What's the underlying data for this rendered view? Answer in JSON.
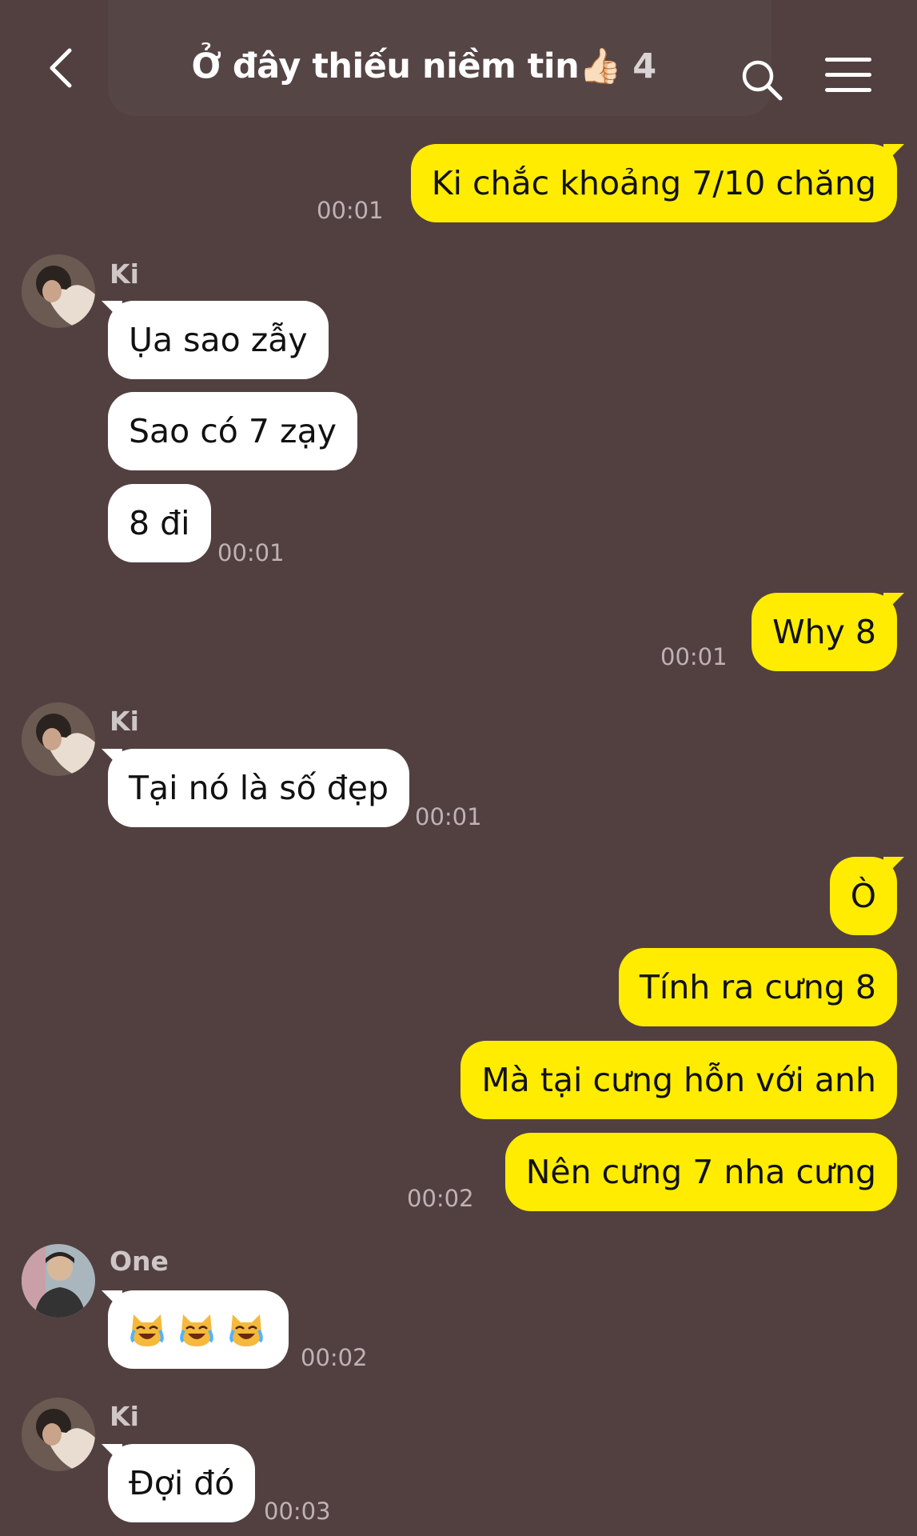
{
  "header": {
    "title": "Ở đây thiếu niềm tin👍🏻",
    "member_count": "4",
    "back_icon": "chevron-left-icon",
    "search_icon": "search-icon",
    "menu_icon": "menu-icon"
  },
  "colors": {
    "background": "#524041",
    "outgoing_bubble": "#ffec00",
    "incoming_bubble": "#ffffff"
  },
  "messages": [
    {
      "direction": "out",
      "text": "Ki chắc khoảng 7/10 chăng",
      "time": "00:01"
    },
    {
      "direction": "in",
      "sender": "Ki",
      "text": "Ụa sao zẫy"
    },
    {
      "direction": "in",
      "text": "Sao có 7 zạy"
    },
    {
      "direction": "in",
      "text": "8 đi",
      "time": "00:01"
    },
    {
      "direction": "out",
      "text": "Why 8",
      "time": "00:01"
    },
    {
      "direction": "in",
      "sender": "Ki",
      "text": "Tại nó là số đẹp",
      "time": "00:01"
    },
    {
      "direction": "out",
      "text": "Ò"
    },
    {
      "direction": "out",
      "text": "Tính ra cưng 8"
    },
    {
      "direction": "out",
      "text": "Mà tại cưng hỗn với anh"
    },
    {
      "direction": "out",
      "text": "Nên cưng 7 nha cưng",
      "time": "00:02"
    },
    {
      "direction": "in",
      "sender": "One",
      "text": "😹😹😹",
      "time": "00:02"
    },
    {
      "direction": "in",
      "sender": "Ki",
      "text": "Đợi đó",
      "time": "00:03"
    }
  ]
}
